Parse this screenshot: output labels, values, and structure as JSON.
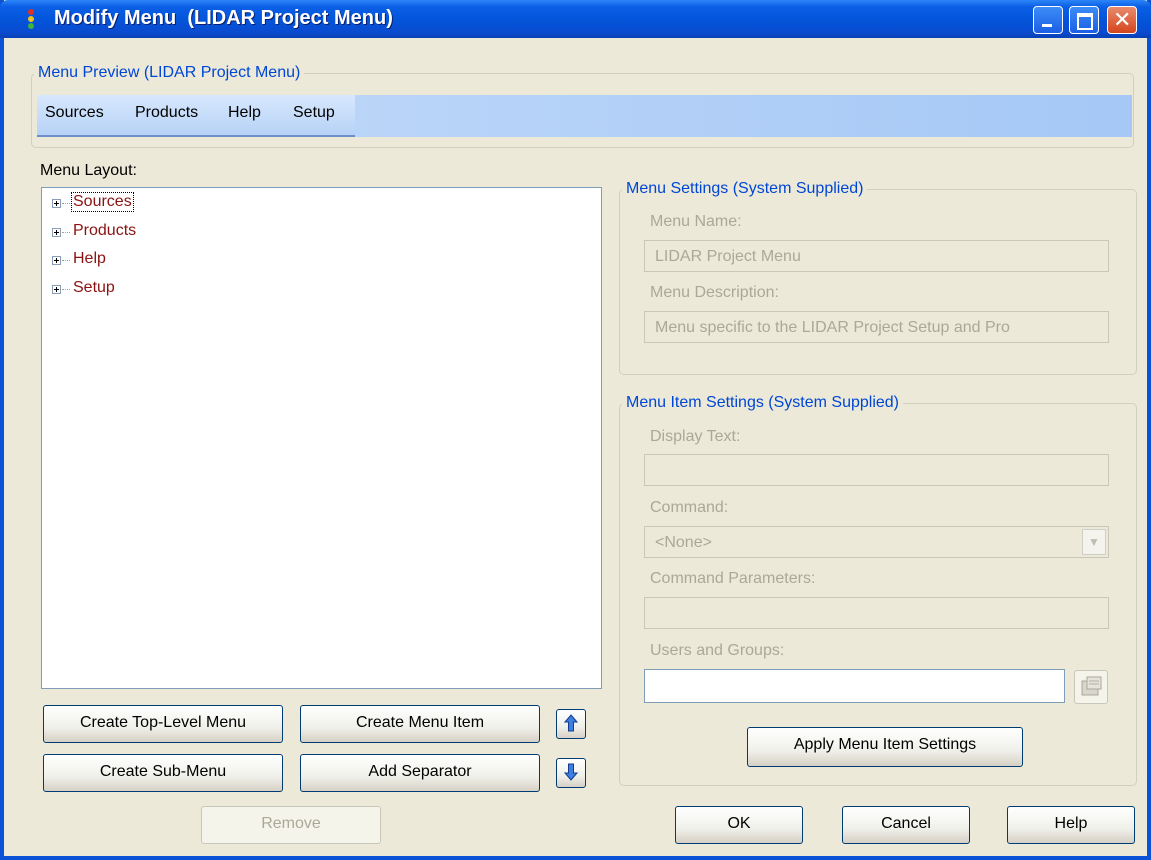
{
  "window": {
    "title": "Modify Menu  (LIDAR Project Menu)"
  },
  "preview": {
    "legend": "Menu Preview  (LIDAR Project Menu)",
    "menu_items": [
      "Sources",
      "Products",
      "Help",
      "Setup"
    ]
  },
  "layout": {
    "label": "Menu Layout:",
    "tree_items": [
      "Sources",
      "Products",
      "Help",
      "Setup"
    ]
  },
  "buttons": {
    "create_top_level": "Create Top-Level Menu",
    "create_menu_item": "Create Menu Item",
    "create_sub_menu": "Create Sub-Menu",
    "add_separator": "Add Separator",
    "remove": "Remove",
    "apply": "Apply Menu Item Settings",
    "ok": "OK",
    "cancel": "Cancel",
    "help": "Help"
  },
  "menu_settings": {
    "legend": "Menu Settings (System Supplied)",
    "name_label": "Menu Name:",
    "name_value": "LIDAR Project Menu",
    "description_label": "Menu Description:",
    "description_value": "Menu specific to the LIDAR Project Setup and Pro"
  },
  "item_settings": {
    "legend": "Menu Item Settings (System Supplied)",
    "display_text_label": "Display Text:",
    "display_text_value": "",
    "command_label": "Command:",
    "command_value": "<None>",
    "parameters_label": "Command Parameters:",
    "parameters_value": "",
    "users_label": "Users and Groups:",
    "users_value": ""
  },
  "colors": {
    "titlebar": "#0a5fe6",
    "legend": "#0046d5",
    "tree_text": "#8b1212"
  }
}
